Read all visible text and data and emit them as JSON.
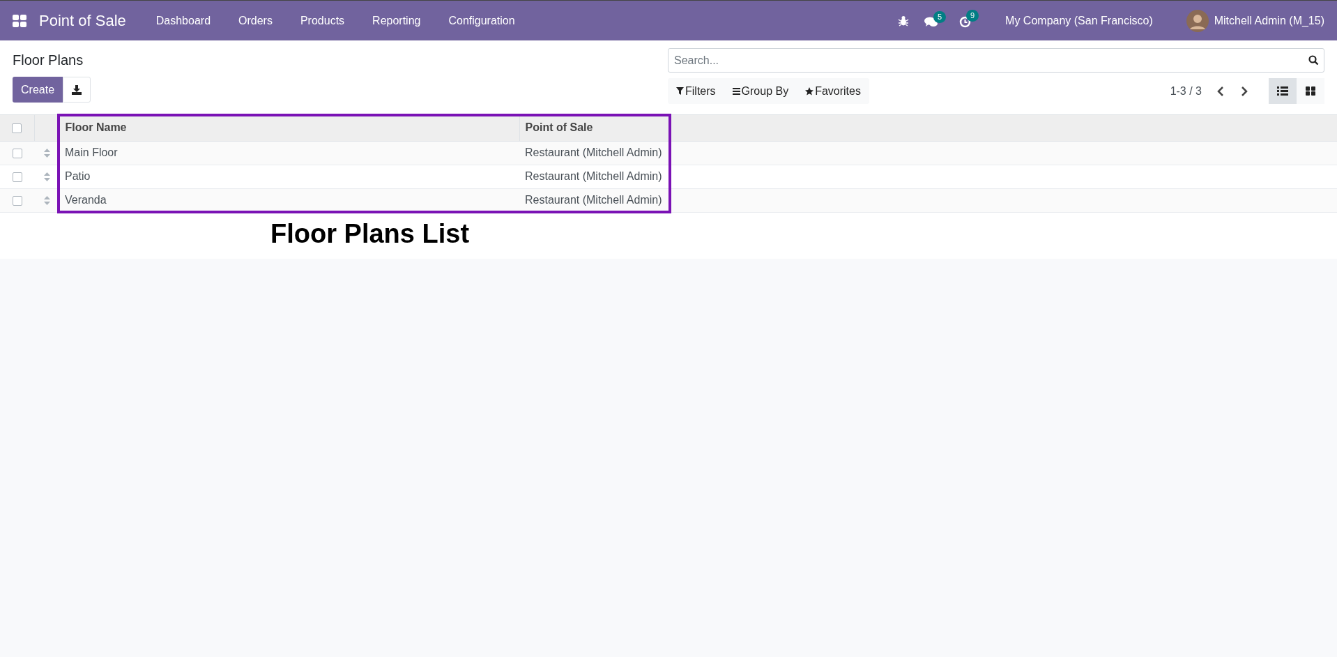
{
  "navbar": {
    "app_title": "Point of Sale",
    "menu": [
      "Dashboard",
      "Orders",
      "Products",
      "Reporting",
      "Configuration"
    ],
    "messages_count": "5",
    "activities_count": "9",
    "company": "My Company (San Francisco)",
    "user": "Mitchell Admin (M_15)"
  },
  "control_panel": {
    "title": "Floor Plans",
    "create_label": "Create",
    "search": {
      "placeholder": "Search..."
    },
    "filters": [
      "Filters",
      "Group By",
      "Favorites"
    ],
    "pager": "1-3 / 3",
    "views": [
      {
        "kind": "list",
        "selected": true
      },
      {
        "kind": "kanban",
        "selected": false
      }
    ]
  },
  "table": {
    "columns": [
      "Floor Name",
      "Point of Sale"
    ],
    "select_all_checked": false,
    "rows": [
      {
        "checked": false,
        "cells": [
          "Main Floor",
          "Restaurant (Mitchell Admin)"
        ]
      },
      {
        "checked": false,
        "cells": [
          "Patio",
          "Restaurant (Mitchell Admin)"
        ]
      },
      {
        "checked": false,
        "cells": [
          "Veranda",
          "Restaurant (Mitchell Admin)"
        ]
      }
    ]
  },
  "annotation": {
    "caption": "Floor Plans List"
  }
}
